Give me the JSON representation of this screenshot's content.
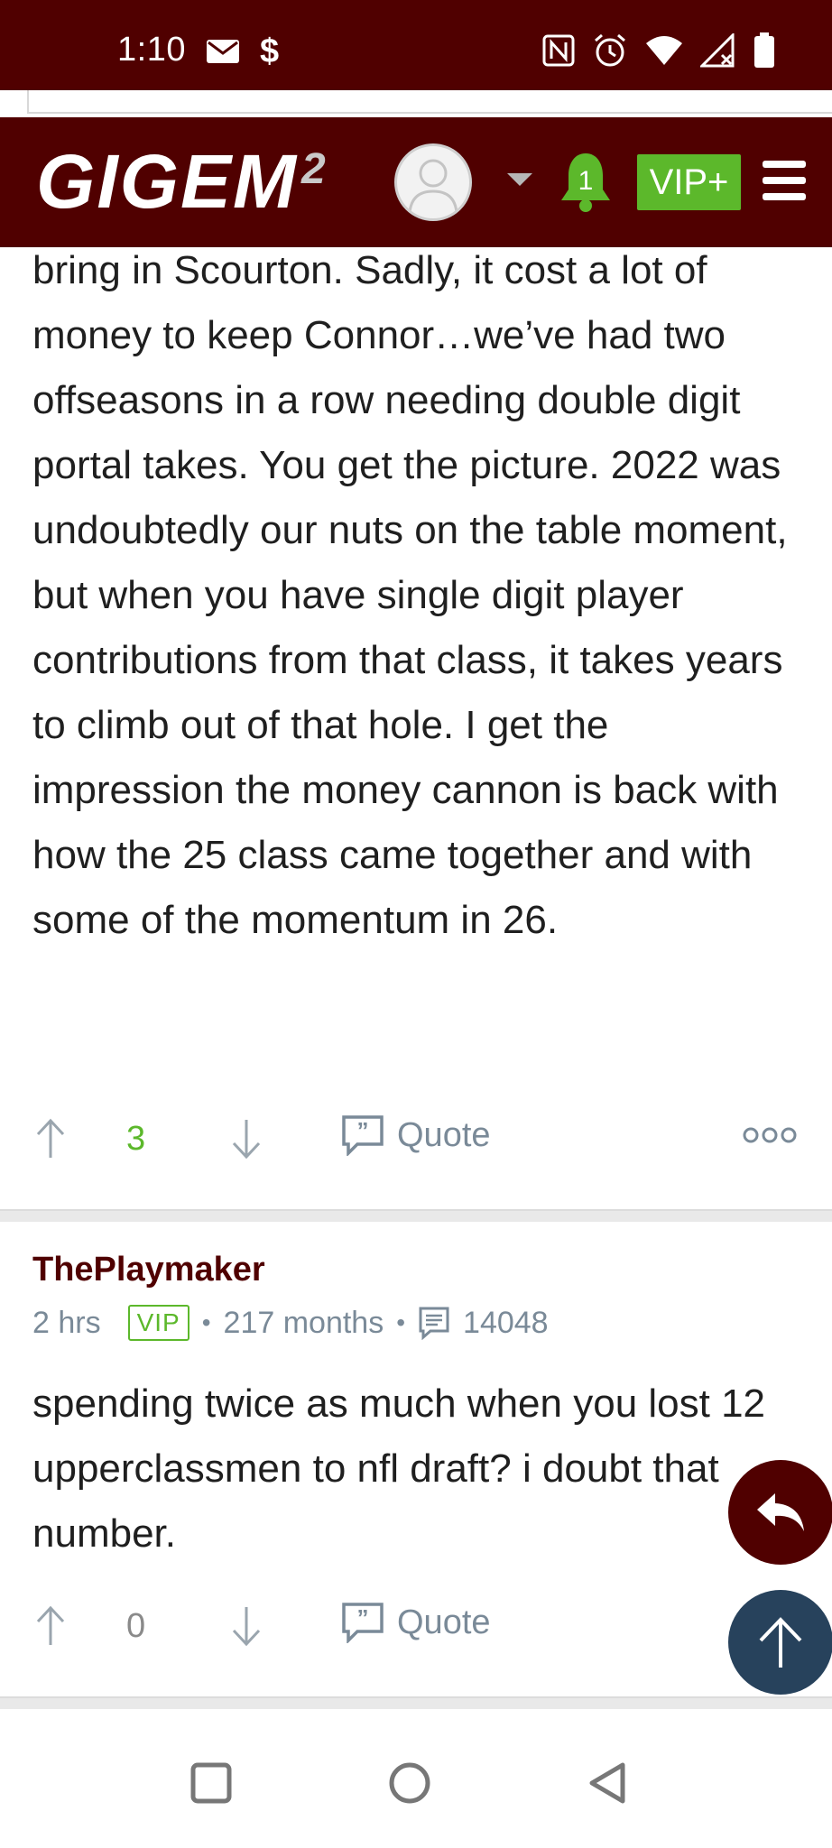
{
  "status_bar": {
    "time": "1:10",
    "icons": [
      "mail-icon",
      "dollar-icon",
      "nfc-icon",
      "alarm-icon",
      "wifi-icon",
      "signal-icon",
      "battery-icon"
    ],
    "dollar": "$"
  },
  "header": {
    "logo_text": "GIGEM",
    "logo_sup": "2",
    "notification_count": "1",
    "vip_label": "VIP+",
    "colors": {
      "brand": "#500000",
      "accent": "#5cb82b"
    }
  },
  "posts": [
    {
      "body": "bring in Scourton. Sadly, it cost a lot of money to keep Connor…we’ve had two offseasons in a row needing double digit portal takes. You get the picture. 2022 was undoubtedly our nuts on the table moment, but when you have single digit player contributions from that class, it takes years to climb out of that hole. I get the impression the money cannon is back with how the 25 class came together and with some of the momentum in 26.",
      "votes": "3",
      "quote_label": "Quote"
    },
    {
      "author": "ThePlaymaker",
      "time_ago": "2 hrs",
      "badge": "VIP",
      "tenure": "217 months",
      "post_count": "14048",
      "body": "spending twice as much when you lost 12 upperclassmen to nfl draft? i doubt that number.",
      "votes": "0",
      "quote_label": "Quote"
    }
  ],
  "nav": {
    "icons": [
      "recents-icon",
      "home-icon",
      "back-icon"
    ]
  }
}
